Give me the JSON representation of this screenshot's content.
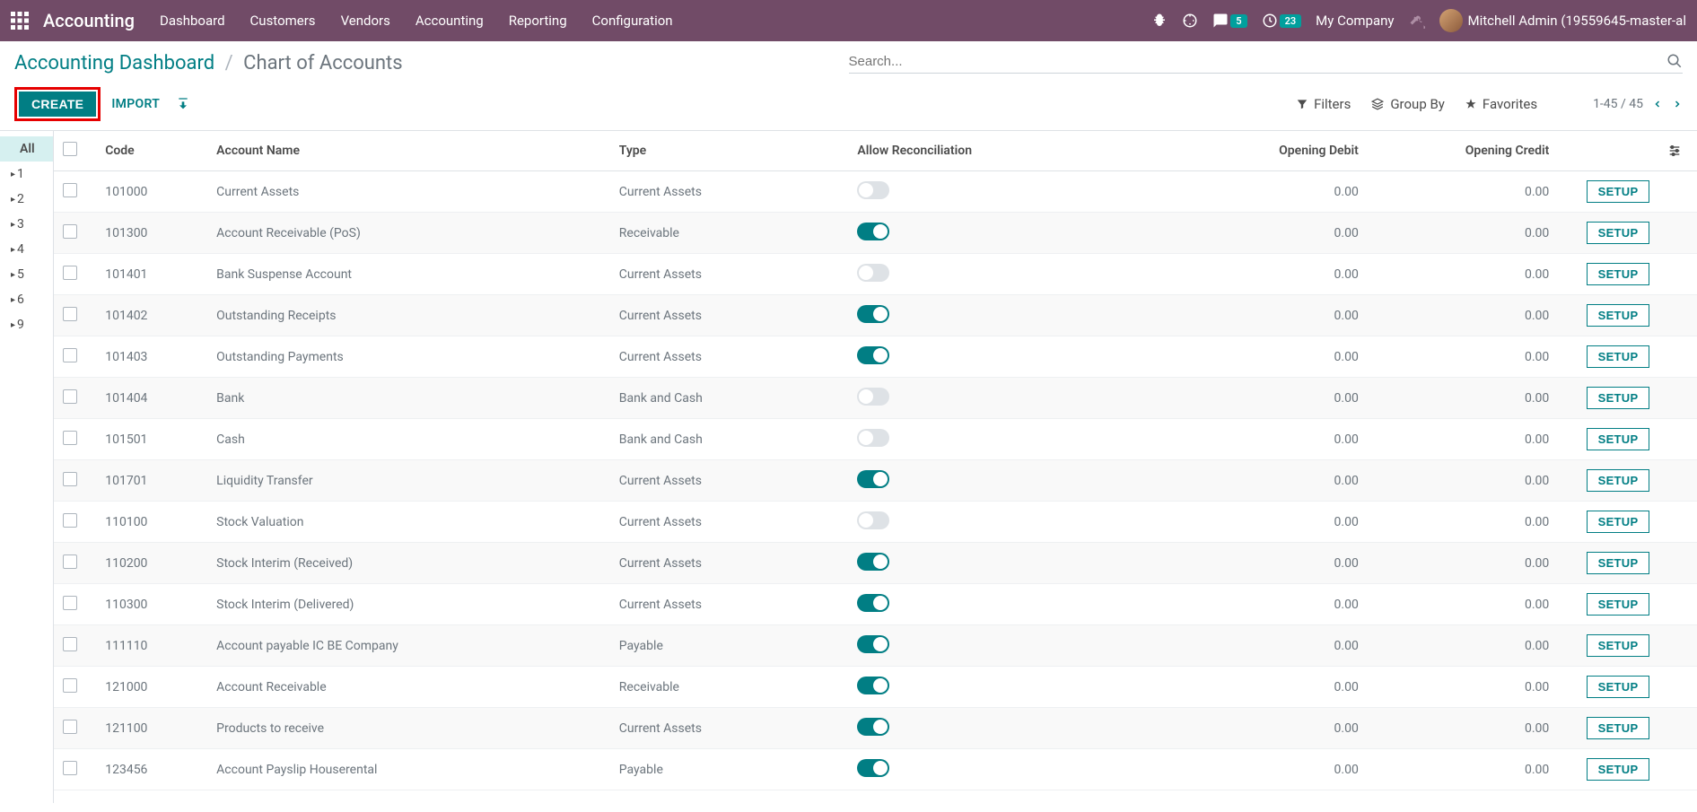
{
  "topbar": {
    "brand": "Accounting",
    "menu": [
      "Dashboard",
      "Customers",
      "Vendors",
      "Accounting",
      "Reporting",
      "Configuration"
    ],
    "msg_badge": "5",
    "activity_badge": "23",
    "company": "My Company",
    "user": "Mitchell Admin (19559645-master-al"
  },
  "breadcrumb": {
    "parent": "Accounting Dashboard",
    "current": "Chart of Accounts"
  },
  "actions": {
    "create": "CREATE",
    "import": "IMPORT"
  },
  "search": {
    "placeholder": "Search...",
    "filters": "Filters",
    "groupby": "Group By",
    "favorites": "Favorites"
  },
  "pager": {
    "text": "1-45 / 45"
  },
  "sidebar": {
    "items": [
      "All",
      "1",
      "2",
      "3",
      "4",
      "5",
      "6",
      "9"
    ]
  },
  "table": {
    "headers": {
      "code": "Code",
      "name": "Account Name",
      "type": "Type",
      "recon": "Allow Reconciliation",
      "debit": "Opening Debit",
      "credit": "Opening Credit"
    },
    "setup_label": "SETUP",
    "rows": [
      {
        "code": "101000",
        "name": "Current Assets",
        "type": "Current Assets",
        "recon": false,
        "debit": "0.00",
        "credit": "0.00"
      },
      {
        "code": "101300",
        "name": "Account Receivable (PoS)",
        "type": "Receivable",
        "recon": true,
        "debit": "0.00",
        "credit": "0.00"
      },
      {
        "code": "101401",
        "name": "Bank Suspense Account",
        "type": "Current Assets",
        "recon": false,
        "debit": "0.00",
        "credit": "0.00"
      },
      {
        "code": "101402",
        "name": "Outstanding Receipts",
        "type": "Current Assets",
        "recon": true,
        "debit": "0.00",
        "credit": "0.00"
      },
      {
        "code": "101403",
        "name": "Outstanding Payments",
        "type": "Current Assets",
        "recon": true,
        "debit": "0.00",
        "credit": "0.00"
      },
      {
        "code": "101404",
        "name": "Bank",
        "type": "Bank and Cash",
        "recon": false,
        "debit": "0.00",
        "credit": "0.00"
      },
      {
        "code": "101501",
        "name": "Cash",
        "type": "Bank and Cash",
        "recon": false,
        "debit": "0.00",
        "credit": "0.00"
      },
      {
        "code": "101701",
        "name": "Liquidity Transfer",
        "type": "Current Assets",
        "recon": true,
        "debit": "0.00",
        "credit": "0.00"
      },
      {
        "code": "110100",
        "name": "Stock Valuation",
        "type": "Current Assets",
        "recon": false,
        "debit": "0.00",
        "credit": "0.00"
      },
      {
        "code": "110200",
        "name": "Stock Interim (Received)",
        "type": "Current Assets",
        "recon": true,
        "debit": "0.00",
        "credit": "0.00"
      },
      {
        "code": "110300",
        "name": "Stock Interim (Delivered)",
        "type": "Current Assets",
        "recon": true,
        "debit": "0.00",
        "credit": "0.00"
      },
      {
        "code": "111110",
        "name": "Account payable IC BE Company",
        "type": "Payable",
        "recon": true,
        "debit": "0.00",
        "credit": "0.00"
      },
      {
        "code": "121000",
        "name": "Account Receivable",
        "type": "Receivable",
        "recon": true,
        "debit": "0.00",
        "credit": "0.00"
      },
      {
        "code": "121100",
        "name": "Products to receive",
        "type": "Current Assets",
        "recon": true,
        "debit": "0.00",
        "credit": "0.00"
      },
      {
        "code": "123456",
        "name": "Account Payslip Houserental",
        "type": "Payable",
        "recon": true,
        "debit": "0.00",
        "credit": "0.00"
      }
    ]
  }
}
